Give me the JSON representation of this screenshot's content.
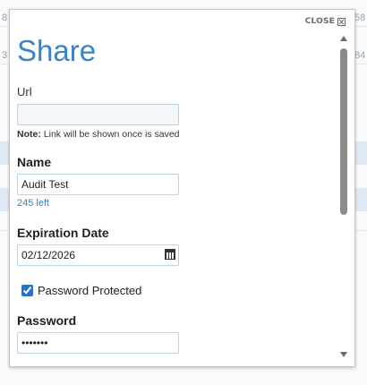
{
  "dialog": {
    "title": "Share",
    "close_label": "CLOSE",
    "close_icon": "close-box-icon"
  },
  "fields": {
    "url": {
      "label": "Url",
      "value": "",
      "note_bold": "Note:",
      "note_text": "Link will be shown once is saved"
    },
    "name": {
      "label": "Name",
      "value": "Audit Test",
      "counter": "245 left"
    },
    "expiration": {
      "label": "Expiration Date",
      "value": "02/12/2026",
      "icon": "calendar-icon"
    },
    "password_protected": {
      "label": "Password Protected",
      "checked": true
    },
    "password": {
      "label": "Password",
      "value": "•••••••"
    }
  },
  "background_numbers": [
    "8",
    "58",
    "3",
    "84"
  ],
  "colors": {
    "accent": "#3a82c9",
    "input_border": "#b9d3ea",
    "checkbox": "#2a6fc9"
  }
}
